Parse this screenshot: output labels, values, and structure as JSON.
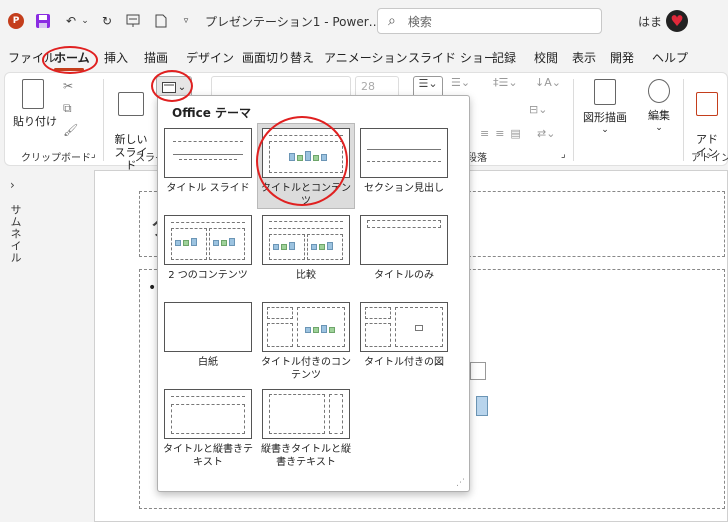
{
  "titlebar": {
    "logo": "P",
    "document_title": "プレゼンテーション1 - Power…",
    "search_placeholder": "検索",
    "user_name": "はま",
    "qat_icons": [
      "save-icon",
      "undo-icon",
      "redo-icon",
      "presenter-icon",
      "new-icon",
      "customize-icon"
    ]
  },
  "menu": {
    "tabs": [
      "ファイル",
      "ホーム",
      "挿入",
      "描画",
      "デザイン",
      "画面切り替え",
      "アニメーション",
      "スライド ショー",
      "記録",
      "校閲",
      "表示",
      "開発",
      "ヘルプ"
    ],
    "active_tab": "ホーム"
  },
  "ribbon": {
    "paste_label": "貼り付け",
    "clipboard_group": "クリップボード",
    "new_slide_label": "新しい\nスライド",
    "slides_group": "スライ",
    "font_size": "28",
    "paragraph_group": "段落",
    "drawing_label": "図形描画",
    "edit_label": "編集",
    "addin_label": "アド\nイン",
    "addin_group": "アドイン"
  },
  "thumbnail_pane": {
    "label": "サムネイル"
  },
  "layout_gallery": {
    "header": "Office テーマ",
    "selected": "タイトルとコンテンツ",
    "layouts": [
      "タイトル スライド",
      "タイトルとコンテンツ",
      "セクション見出し",
      "2 つのコンテンツ",
      "比較",
      "タイトルのみ",
      "白紙",
      "タイトル付きのコンテンツ",
      "タイトル付きの図",
      "タイトルと縦書きテキスト",
      "縦書きタイトルと縦書きテキスト"
    ]
  },
  "colors": {
    "accent": "#c43e1c",
    "annotation": "#e02020"
  }
}
